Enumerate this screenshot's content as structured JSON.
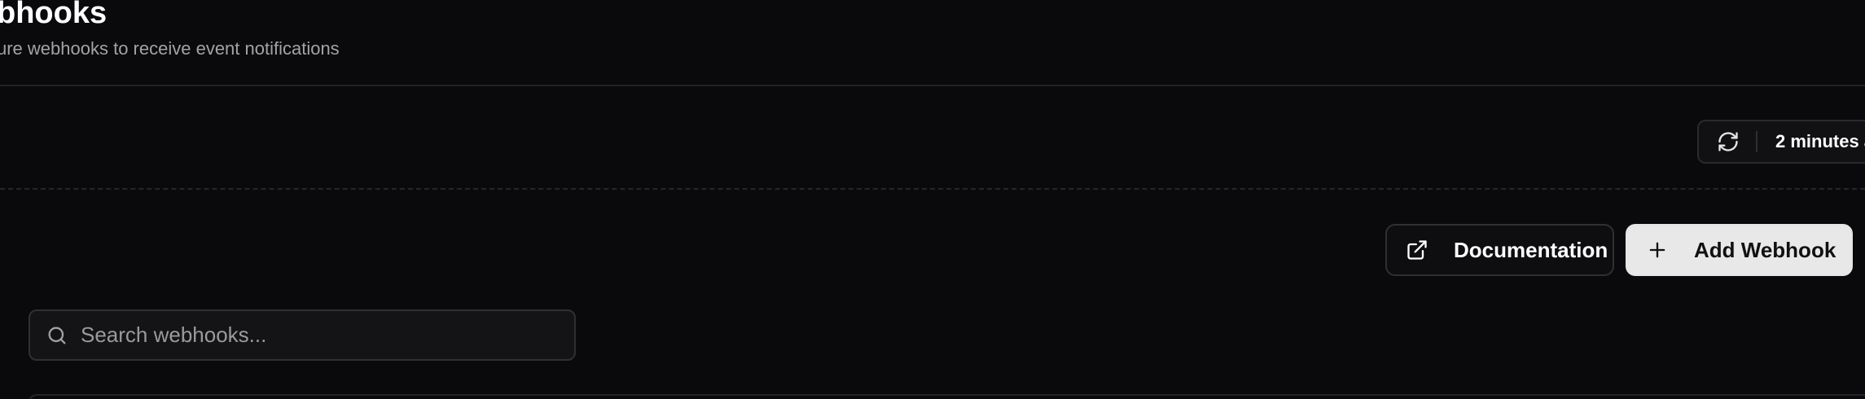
{
  "header": {
    "title": "bhooks",
    "subtitle": "ure webhooks to receive event notifications"
  },
  "refresh": {
    "icon": "refresh-icon",
    "label": "2 minutes a"
  },
  "actions": {
    "docs_label": "Documentation",
    "docs_icon": "external-link-icon",
    "add_label": "Add Webhook",
    "add_icon": "plus-icon"
  },
  "search": {
    "placeholder": "Search webhooks...",
    "value": "",
    "icon": "search-icon"
  },
  "colors": {
    "background": "#0a0a0c",
    "primary_button": "#e8e8e8",
    "border": "#2f2f34",
    "muted_text": "#a3a3a3"
  }
}
